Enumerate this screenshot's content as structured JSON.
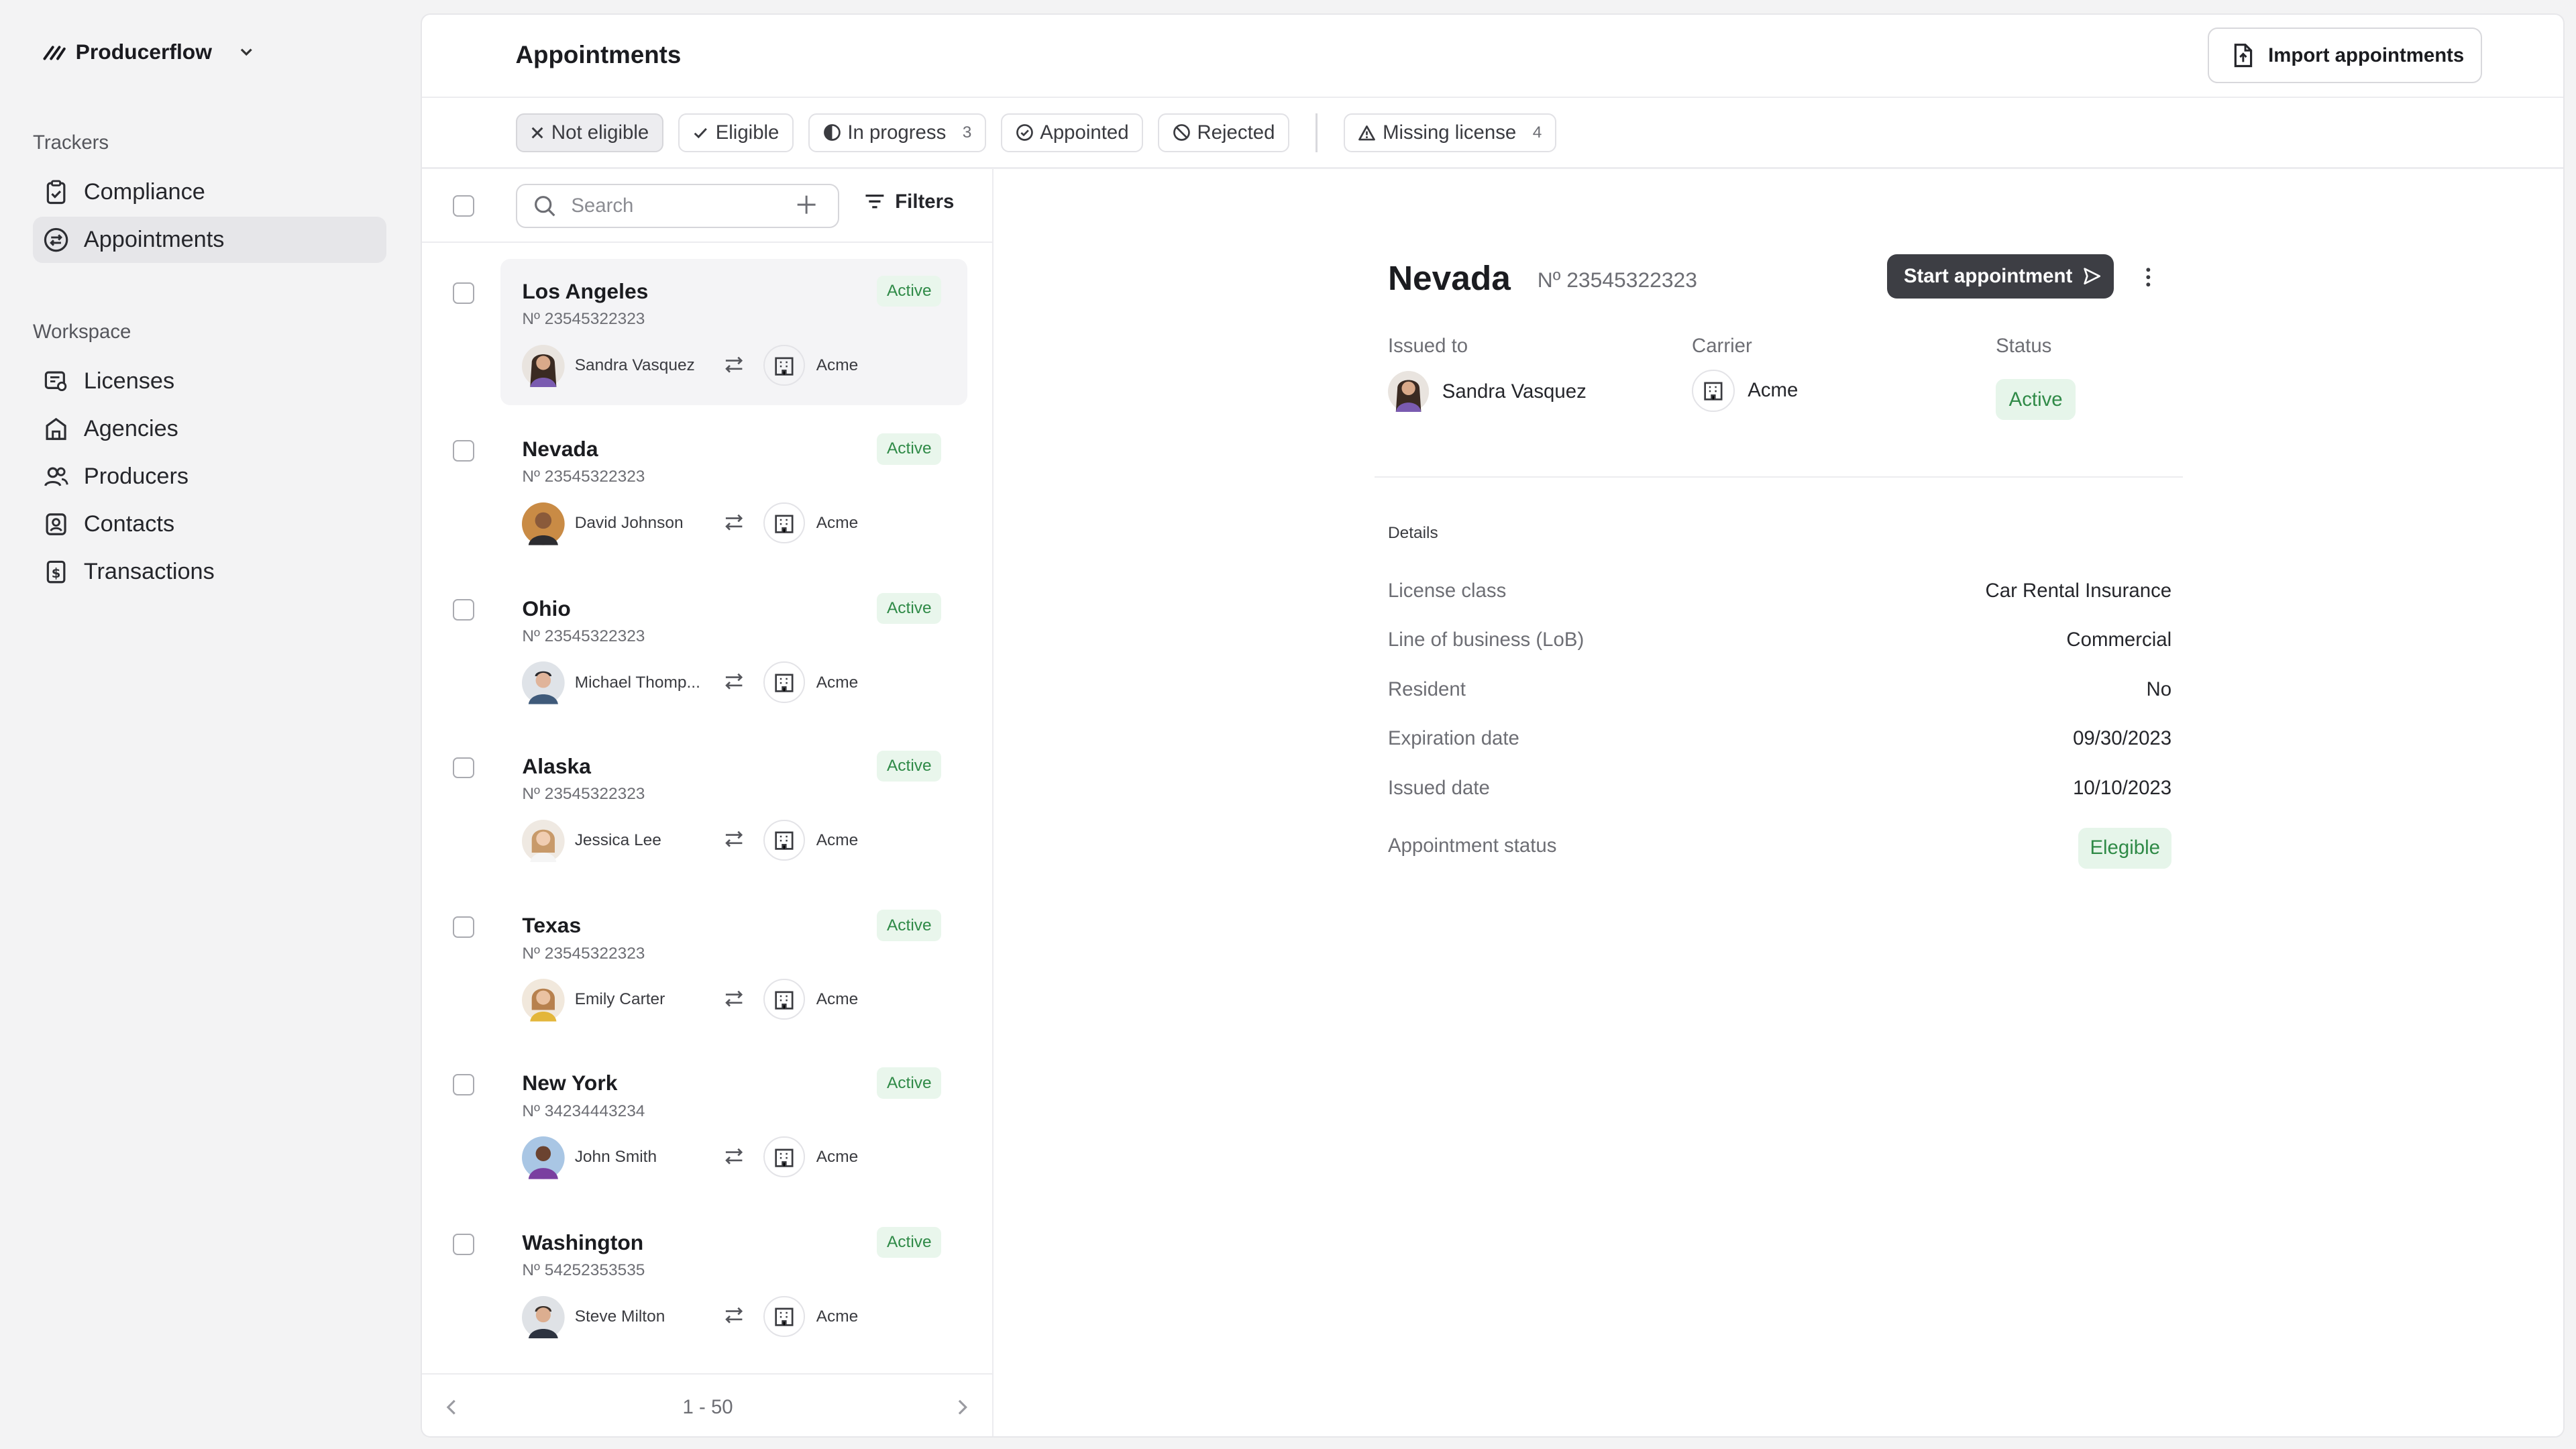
{
  "app": {
    "name": "Producerflow"
  },
  "sidebar": {
    "sections": [
      {
        "title": "Trackers",
        "items": [
          {
            "label": "Compliance",
            "icon": "clipboard-check-icon"
          },
          {
            "label": "Appointments",
            "icon": "arrows-exchange-icon",
            "active": true
          }
        ]
      },
      {
        "title": "Workspace",
        "items": [
          {
            "label": "Licenses",
            "icon": "license-icon"
          },
          {
            "label": "Agencies",
            "icon": "building-icon"
          },
          {
            "label": "Producers",
            "icon": "users-icon"
          },
          {
            "label": "Contacts",
            "icon": "contacts-icon"
          },
          {
            "label": "Transactions",
            "icon": "dollar-receipt-icon"
          }
        ]
      }
    ]
  },
  "header": {
    "title": "Appointments",
    "import_label": "Import appointments"
  },
  "chips": [
    {
      "label": "Not eligible",
      "icon": "x-icon",
      "selected": true,
      "count": ""
    },
    {
      "label": "Eligible",
      "icon": "check-icon",
      "count": ""
    },
    {
      "label": "In progress",
      "icon": "half-circle-icon",
      "count": "3"
    },
    {
      "label": "Appointed",
      "icon": "check-circle-icon",
      "count": ""
    },
    {
      "label": "Rejected",
      "icon": "ban-icon",
      "count": ""
    },
    {
      "label": "Missing license",
      "icon": "warning-icon",
      "count": "4"
    }
  ],
  "list": {
    "search_placeholder": "Search",
    "filters_label": "Filters",
    "rows": [
      {
        "name": "Los Angeles",
        "number": "Nº 23545322323",
        "status": "Active",
        "producer": "Sandra Vasquez",
        "carrier": "Acme",
        "active": true
      },
      {
        "name": "Nevada",
        "number": "Nº 23545322323",
        "status": "Active",
        "producer": "David Johnson",
        "carrier": "Acme"
      },
      {
        "name": "Ohio",
        "number": "Nº 23545322323",
        "status": "Active",
        "producer": "Michael Thomp...",
        "carrier": "Acme"
      },
      {
        "name": "Alaska",
        "number": "Nº 23545322323",
        "status": "Active",
        "producer": "Jessica Lee",
        "carrier": "Acme"
      },
      {
        "name": "Texas",
        "number": "Nº 23545322323",
        "status": "Active",
        "producer": "Emily Carter",
        "carrier": "Acme"
      },
      {
        "name": "New York",
        "number": "Nº 34234443234",
        "status": "Active",
        "producer": "John Smith",
        "carrier": "Acme"
      },
      {
        "name": "Washington",
        "number": "Nº 54252353535",
        "status": "Active",
        "producer": "Steve Milton",
        "carrier": "Acme"
      }
    ],
    "pagination": "1 - 50"
  },
  "detail": {
    "title": "Nevada",
    "number": "Nº 23545322323",
    "start_label": "Start appointment",
    "issued_to_label": "Issued to",
    "issued_to": "Sandra Vasquez",
    "carrier_label": "Carrier",
    "carrier": "Acme",
    "status_label": "Status",
    "status": "Active",
    "details_heading": "Details",
    "fields": [
      {
        "label": "License class",
        "value": "Car Rental Insurance"
      },
      {
        "label": "Line of business (LoB)",
        "value": "Commercial"
      },
      {
        "label": "Resident",
        "value": "No"
      },
      {
        "label": "Expiration date",
        "value": "09/30/2023"
      },
      {
        "label": "Issued date",
        "value": "10/10/2023"
      },
      {
        "label": "Appointment status",
        "value": "Elegible",
        "badge": true
      }
    ]
  },
  "colors": {
    "accent_dark": "#3d3e44",
    "success_bg": "#e6f5ea",
    "success_text": "#2f8a47"
  }
}
